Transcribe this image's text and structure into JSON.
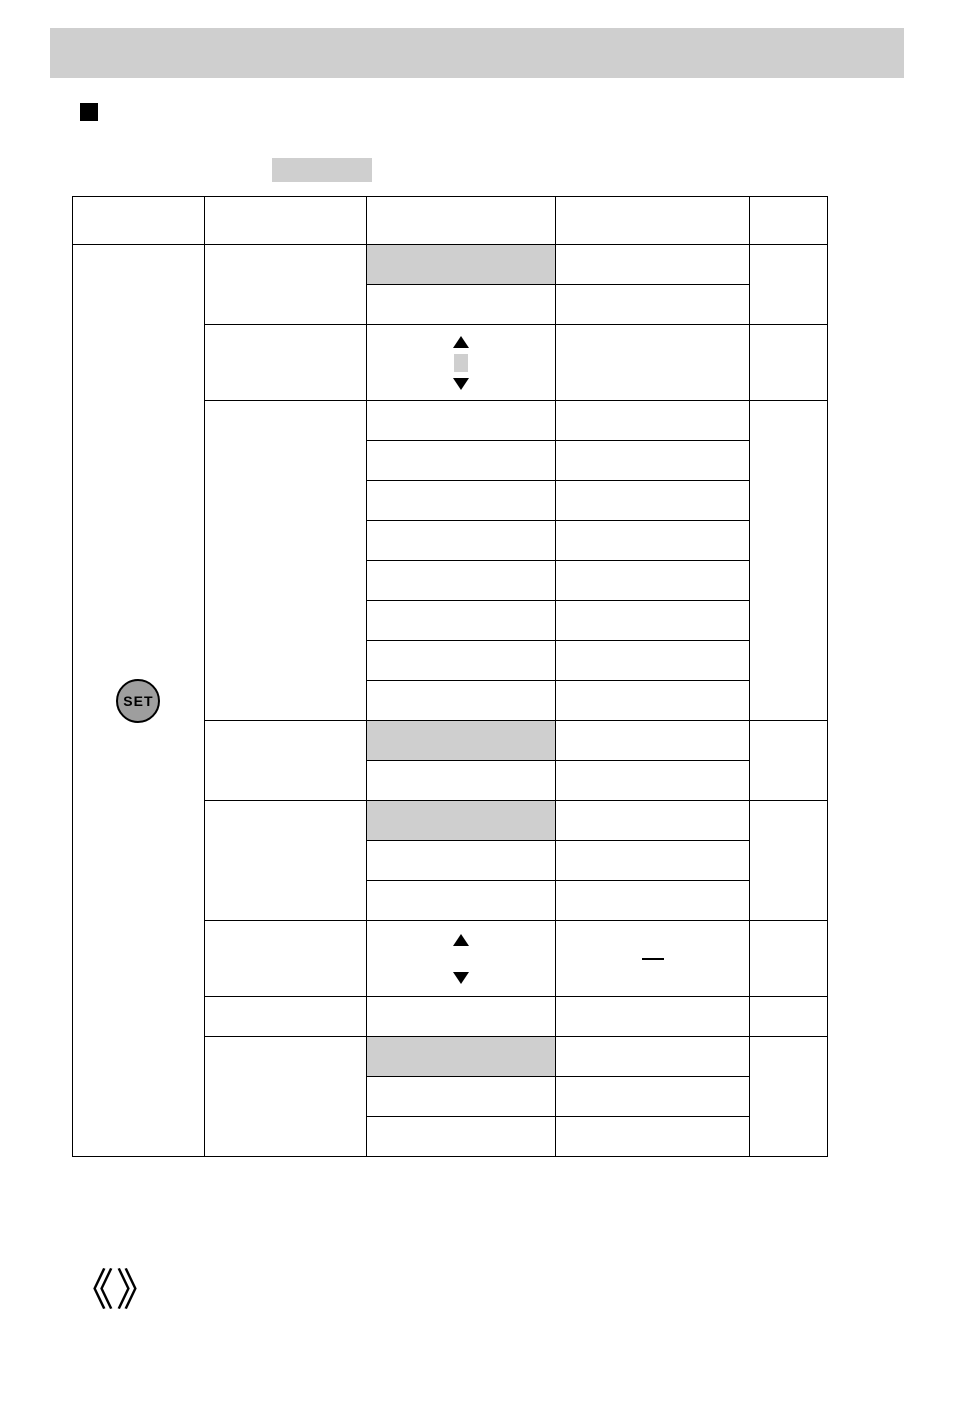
{
  "icons": {
    "set_label": "SET"
  },
  "table": {
    "header": [
      "",
      "",
      "",
      "",
      ""
    ],
    "rows": [
      {
        "type": "group2",
        "b": "",
        "c_top_shaded": true,
        "d_top": "",
        "d_bot": "",
        "e": ""
      },
      {
        "type": "arrow3",
        "b": "",
        "mid_has_square": true,
        "d": "",
        "e": ""
      },
      {
        "type": "group8",
        "b": "",
        "cells": [
          {
            "c": "",
            "d": ""
          },
          {
            "c": "",
            "d": ""
          },
          {
            "c": "",
            "d": ""
          },
          {
            "c": "",
            "d": ""
          },
          {
            "c": "",
            "d": ""
          },
          {
            "c": "",
            "d": ""
          },
          {
            "c": "",
            "d": ""
          },
          {
            "c": "",
            "d": ""
          }
        ],
        "e": ""
      },
      {
        "type": "group2",
        "b": "",
        "c_top_shaded": true,
        "d_top": "",
        "d_bot": "",
        "e": ""
      },
      {
        "type": "group3",
        "b": "",
        "c_shaded_index": 0,
        "cells": [
          {
            "c": "",
            "d": ""
          },
          {
            "c": "",
            "d": ""
          },
          {
            "c": "",
            "d": ""
          }
        ],
        "e": ""
      },
      {
        "type": "arrow3",
        "b": "",
        "mid_has_square": false,
        "d": "dash",
        "e": ""
      },
      {
        "type": "single",
        "b": "",
        "c": "",
        "d": "",
        "e": ""
      },
      {
        "type": "group3",
        "b": "",
        "c_shaded_index": 0,
        "cells": [
          {
            "c": "",
            "d": ""
          },
          {
            "c": "",
            "d": ""
          },
          {
            "c": "",
            "d": ""
          }
        ],
        "e": ""
      }
    ]
  },
  "footer_angles": {
    "left": "《",
    "right": "》"
  }
}
